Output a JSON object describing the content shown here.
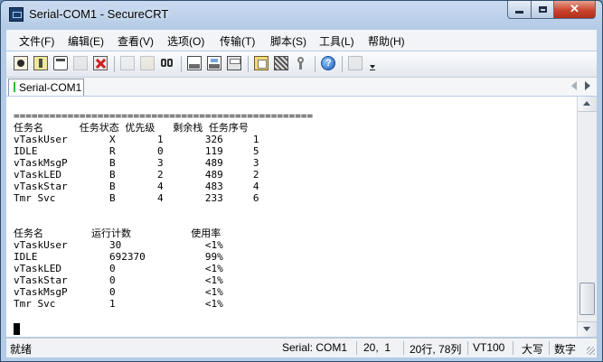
{
  "window": {
    "title": "Serial-COM1 - SecureCRT"
  },
  "menu": [
    "文件(F)",
    "编辑(E)",
    "查看(V)",
    "选项(O)",
    "传输(T)",
    "脚本(S)",
    "工具(L)",
    "帮助(H)"
  ],
  "toolbar_icons": [
    "connect-icon",
    "quick-connect-icon",
    "connect-tab-icon",
    "reconnect-icon",
    "disconnect-icon",
    "copy-icon",
    "paste-icon",
    "find-icon",
    "print-icon",
    "print-selection-icon",
    "print-setup-icon",
    "session-options-icon",
    "global-options-icon",
    "keymap-icon",
    "help-icon",
    "sftp-icon",
    "toolbar-overflow-icon"
  ],
  "tab": {
    "label": "Serial-COM1"
  },
  "terminal": {
    "lines": [
      "==================================================",
      "任务名      任务状态 优先级   剩余栈 任务序号",
      "vTaskUser       X       1       326     1",
      "IDLE            R       0       119     5",
      "vTaskMsgP       B       3       489     3",
      "vTaskLED        B       2       489     2",
      "vTaskStar       B       4       483     4",
      "Tmr Svc         B       4       233     6",
      "",
      "",
      "任务名        运行计数          使用率",
      "vTaskUser       30              <1%",
      "IDLE            692370          99%",
      "vTaskLED        0               <1%",
      "vTaskStar       0               <1%",
      "vTaskMsgP       0               <1%",
      "Tmr Svc         1               <1%"
    ]
  },
  "status": {
    "ready": "就绪",
    "session": "Serial: COM1",
    "cursor_pos": "20,  1",
    "size": "20行, 78列",
    "emulation": "VT100",
    "caps": "大写",
    "num": "数字"
  },
  "colors": {
    "accent": "#c9442c",
    "terminal_bg": "#ffffff",
    "terminal_fg": "#000000",
    "tab_indicator": "#2fb82f"
  }
}
